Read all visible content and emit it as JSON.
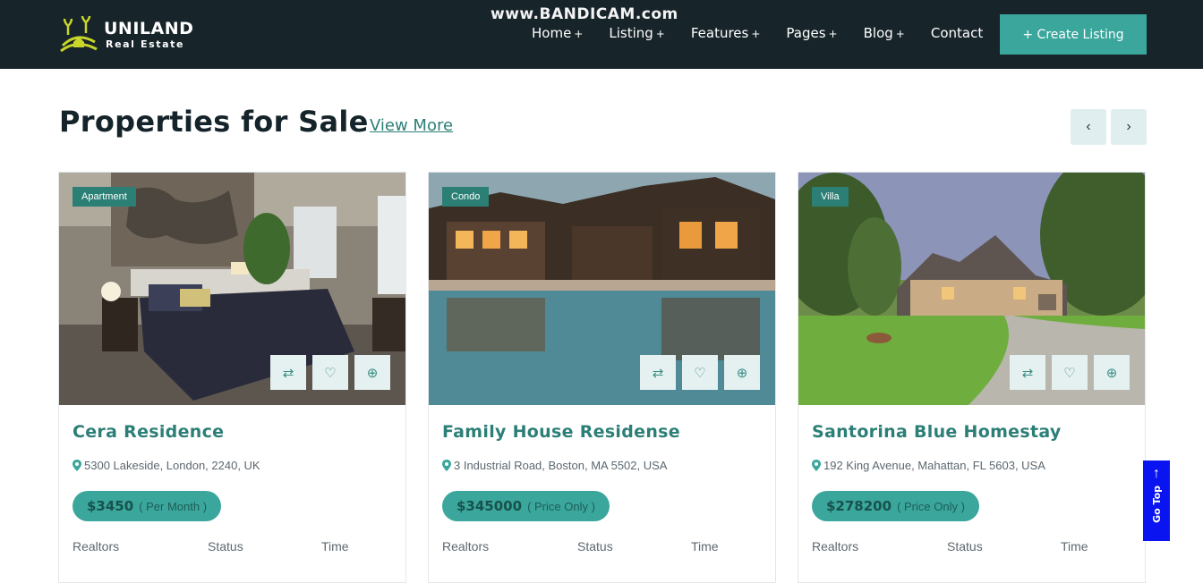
{
  "header": {
    "logo_name": "UNILAND",
    "logo_sub": "Real Estate",
    "watermark": "www.BANDICAM.com",
    "nav": [
      {
        "label": "Home",
        "suffix": "+"
      },
      {
        "label": "Listing",
        "suffix": "+"
      },
      {
        "label": "Features",
        "suffix": "+"
      },
      {
        "label": "Pages",
        "suffix": "+"
      },
      {
        "label": "Blog",
        "suffix": "+"
      },
      {
        "label": "Contact",
        "suffix": ""
      }
    ],
    "create_label": "+ Create Listing"
  },
  "section": {
    "title": "Properties for Sale",
    "view_more": "View More",
    "prev_icon": "‹",
    "next_icon": "›"
  },
  "cards": [
    {
      "tag": "Apartment",
      "title": "Cera Residence",
      "address": "5300 Lakeside, London, 2240, UK",
      "price": "$3450",
      "price_note": "( Per Month )",
      "meta": [
        "Realtors",
        "Status",
        "Time"
      ]
    },
    {
      "tag": "Condo",
      "title": "Family House Residense",
      "address": "3 Industrial Road, Boston, MA 5502, USA",
      "price": "$345000",
      "price_note": "( Price Only )",
      "meta": [
        "Realtors",
        "Status",
        "Time"
      ]
    },
    {
      "tag": "Villa",
      "title": "Santorina Blue Homestay",
      "address": "192 King Avenue, Mahattan, FL 5603, USA",
      "price": "$278200",
      "price_note": "( Price Only )",
      "meta": [
        "Realtors",
        "Status",
        "Time"
      ]
    }
  ],
  "icons": {
    "compare": "⇄",
    "heart": "♡",
    "zoom": "⊕"
  },
  "go_top": {
    "arrow": "↑",
    "label": "Go Top"
  },
  "colors": {
    "header_bg": "#17242a",
    "accent": "#3aa69c",
    "tag_bg": "#2b7f75",
    "go_top_bg": "#0a14f0"
  }
}
